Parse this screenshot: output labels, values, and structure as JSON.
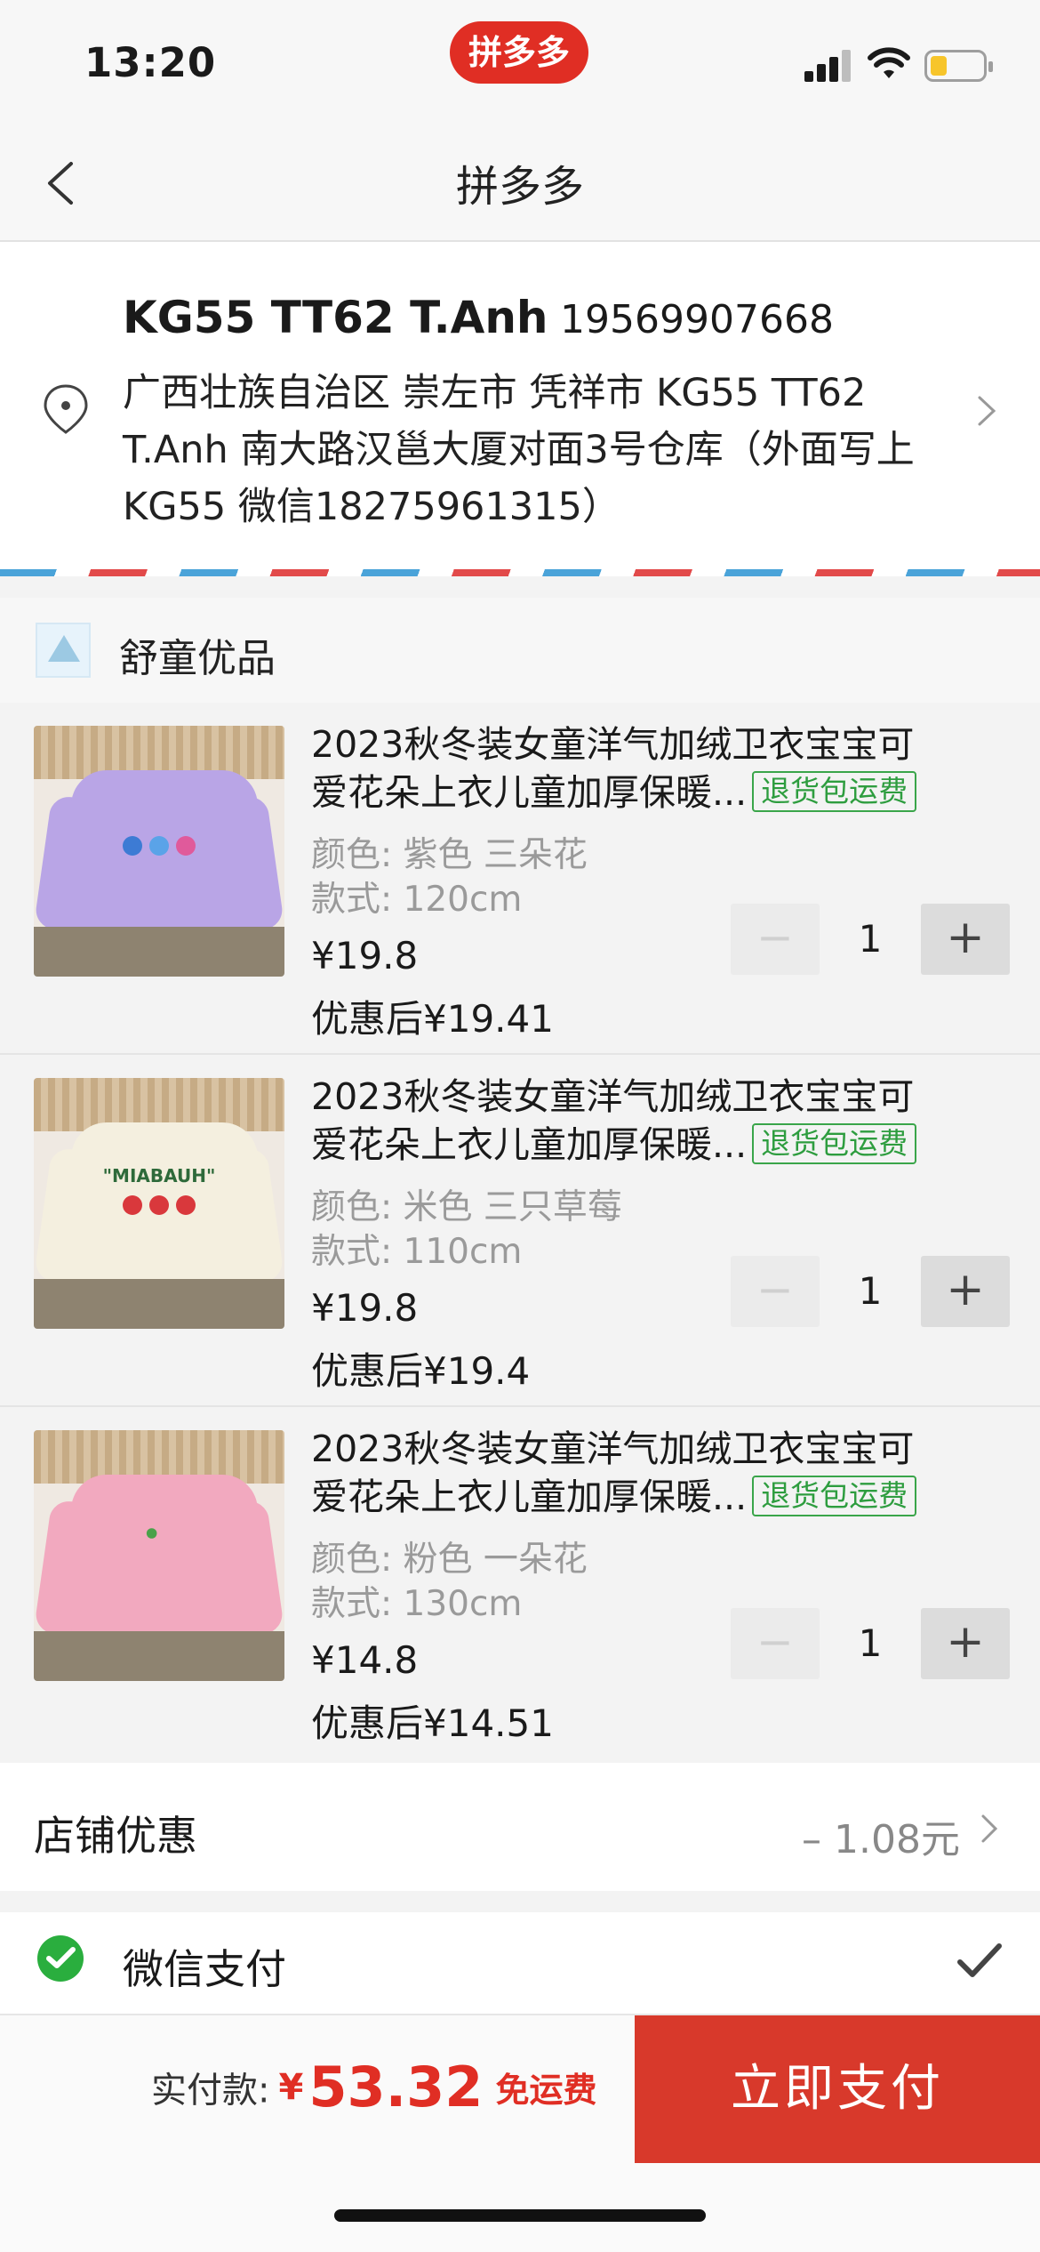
{
  "status_bar": {
    "time": "13:20",
    "app_badge": "拼多多"
  },
  "nav": {
    "title": "拼多多"
  },
  "address": {
    "name": "KG55 TT62 T.Anh",
    "phone": "19569907668",
    "detail": "广西壮族自治区 崇左市 凭祥市 KG55 TT62 T.Anh 南大路汉邕大厦对面3号仓库（外面写上KG55 微信18275961315）"
  },
  "shop": {
    "name": "舒童优品",
    "logo_icon": "shop-logo-icon"
  },
  "items": [
    {
      "title": "2023秋冬装女童洋气加绒卫衣宝宝可爱花朵上衣儿童加厚保暖...",
      "title_line1": "2023秋冬装女童洋气加绒卫衣宝宝可",
      "title_line2": "爱花朵上衣儿童加厚保暖...",
      "tag": "退货包运费",
      "color": "颜色: 紫色 三朵花",
      "style": "款式: 120cm",
      "price": "¥19.8",
      "price_after": "优惠后¥19.41",
      "quantity": "1",
      "minus_label": "−",
      "plus_label": "+",
      "shirt_color": "#b9a5e6",
      "print_text": ""
    },
    {
      "title": "2023秋冬装女童洋气加绒卫衣宝宝可爱花朵上衣儿童加厚保暖...",
      "title_line1": "2023秋冬装女童洋气加绒卫衣宝宝可",
      "title_line2": "爱花朵上衣儿童加厚保暖...",
      "tag": "退货包运费",
      "color": "颜色: 米色 三只草莓",
      "style": "款式: 110cm",
      "price": "¥19.8",
      "price_after": "优惠后¥19.4",
      "quantity": "1",
      "minus_label": "−",
      "plus_label": "+",
      "shirt_color": "#f4efdf",
      "print_text": "\"MIABAUH\""
    },
    {
      "title": "2023秋冬装女童洋气加绒卫衣宝宝可爱花朵上衣儿童加厚保暖...",
      "title_line1": "2023秋冬装女童洋气加绒卫衣宝宝可",
      "title_line2": "爱花朵上衣儿童加厚保暖...",
      "tag": "退货包运费",
      "color": "颜色: 粉色 一朵花",
      "style": "款式: 130cm",
      "price": "¥14.8",
      "price_after": "优惠后¥14.51",
      "quantity": "1",
      "minus_label": "−",
      "plus_label": "+",
      "shirt_color": "#f2a9bf",
      "print_text": ""
    }
  ],
  "discount": {
    "label": "店铺优惠",
    "value": "– 1.08元"
  },
  "payment": {
    "method": "微信支付"
  },
  "bottom": {
    "total_label": "实付款:",
    "currency": "¥",
    "total_amount": "53.32",
    "free_shipping": "免运费",
    "pay_button": "立即支付"
  },
  "colors": {
    "accent": "#e02e24",
    "pay_button": "#d8392b",
    "tag_green": "#2e9d3f",
    "wechat_green": "#2aae3e"
  }
}
